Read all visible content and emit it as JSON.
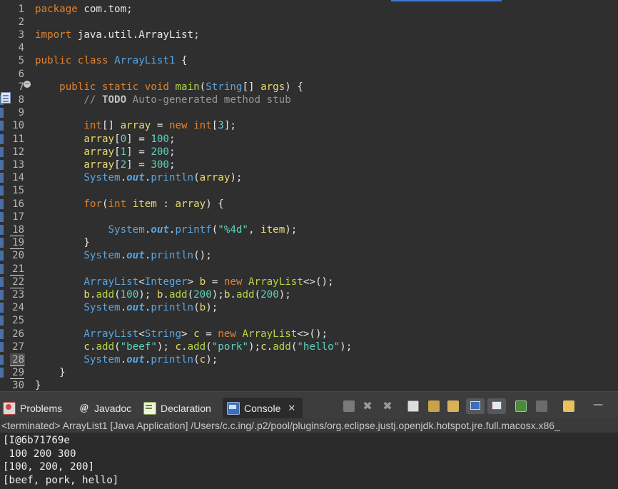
{
  "editor": {
    "line_numbers": [
      "1",
      "2",
      "3",
      "4",
      "5",
      "6",
      "7",
      "8",
      "9",
      "10",
      "11",
      "12",
      "13",
      "14",
      "15",
      "16",
      "17",
      "18",
      "19",
      "20",
      "21",
      "22",
      "23",
      "24",
      "25",
      "26",
      "27",
      "28",
      "29",
      "30"
    ],
    "lines": [
      [
        [
          "k",
          "package"
        ],
        [
          "p",
          " com.tom;"
        ]
      ],
      [],
      [
        [
          "k",
          "import"
        ],
        [
          "p",
          " java.util.ArrayList;"
        ]
      ],
      [],
      [
        [
          "k",
          "public"
        ],
        [
          "p",
          " "
        ],
        [
          "k",
          "class"
        ],
        [
          "p",
          " "
        ],
        [
          "t",
          "ArrayList1"
        ],
        [
          "p",
          " {"
        ]
      ],
      [],
      [
        [
          "p",
          "    "
        ],
        [
          "k",
          "public"
        ],
        [
          "p",
          " "
        ],
        [
          "k",
          "static"
        ],
        [
          "p",
          " "
        ],
        [
          "k",
          "void"
        ],
        [
          "p",
          " "
        ],
        [
          "f",
          "main"
        ],
        [
          "p",
          "("
        ],
        [
          "t",
          "String"
        ],
        [
          "p",
          "[] "
        ],
        [
          "v",
          "args"
        ],
        [
          "p",
          ") {"
        ]
      ],
      [
        [
          "p",
          "        "
        ],
        [
          "c",
          "// "
        ],
        [
          "cb",
          "TODO"
        ],
        [
          "c",
          " Auto-generated method stub"
        ]
      ],
      [],
      [
        [
          "p",
          "        "
        ],
        [
          "k",
          "int"
        ],
        [
          "p",
          "[] "
        ],
        [
          "v",
          "array"
        ],
        [
          "p",
          " = "
        ],
        [
          "k",
          "new"
        ],
        [
          "p",
          " "
        ],
        [
          "k",
          "int"
        ],
        [
          "p",
          "["
        ],
        [
          "s",
          "3"
        ],
        [
          "p",
          "];"
        ]
      ],
      [
        [
          "p",
          "        "
        ],
        [
          "v",
          "array"
        ],
        [
          "p",
          "["
        ],
        [
          "s",
          "0"
        ],
        [
          "p",
          "] = "
        ],
        [
          "s",
          "100"
        ],
        [
          "p",
          ";"
        ]
      ],
      [
        [
          "p",
          "        "
        ],
        [
          "v",
          "array"
        ],
        [
          "p",
          "["
        ],
        [
          "s",
          "1"
        ],
        [
          "p",
          "] = "
        ],
        [
          "s",
          "200"
        ],
        [
          "p",
          ";"
        ]
      ],
      [
        [
          "p",
          "        "
        ],
        [
          "v",
          "array"
        ],
        [
          "p",
          "["
        ],
        [
          "s",
          "2"
        ],
        [
          "p",
          "] = "
        ],
        [
          "s",
          "300"
        ],
        [
          "p",
          ";"
        ]
      ],
      [
        [
          "p",
          "        "
        ],
        [
          "t",
          "System"
        ],
        [
          "p",
          "."
        ],
        [
          "st",
          "out"
        ],
        [
          "p",
          "."
        ],
        [
          "t",
          "println"
        ],
        [
          "p",
          "("
        ],
        [
          "v",
          "array"
        ],
        [
          "p",
          ");"
        ]
      ],
      [],
      [
        [
          "p",
          "        "
        ],
        [
          "k",
          "for"
        ],
        [
          "p",
          "("
        ],
        [
          "k",
          "int"
        ],
        [
          "p",
          " "
        ],
        [
          "v",
          "item"
        ],
        [
          "p",
          " : "
        ],
        [
          "v",
          "array"
        ],
        [
          "p",
          ") {"
        ]
      ],
      [],
      [
        [
          "p",
          "            "
        ],
        [
          "t",
          "System"
        ],
        [
          "p",
          "."
        ],
        [
          "st",
          "out"
        ],
        [
          "p",
          "."
        ],
        [
          "t",
          "printf"
        ],
        [
          "p",
          "("
        ],
        [
          "s",
          "\"%4d\""
        ],
        [
          "p",
          ", "
        ],
        [
          "v",
          "item"
        ],
        [
          "p",
          ");"
        ]
      ],
      [
        [
          "p",
          "        }"
        ]
      ],
      [
        [
          "p",
          "        "
        ],
        [
          "t",
          "System"
        ],
        [
          "p",
          "."
        ],
        [
          "st",
          "out"
        ],
        [
          "p",
          "."
        ],
        [
          "t",
          "println"
        ],
        [
          "p",
          "();"
        ]
      ],
      [],
      [
        [
          "p",
          "        "
        ],
        [
          "t",
          "ArrayList"
        ],
        [
          "p",
          "<"
        ],
        [
          "t",
          "Integer"
        ],
        [
          "p",
          "> "
        ],
        [
          "v",
          "b"
        ],
        [
          "p",
          " = "
        ],
        [
          "k",
          "new"
        ],
        [
          "p",
          " "
        ],
        [
          "f",
          "ArrayList"
        ],
        [
          "p",
          "<>();"
        ]
      ],
      [
        [
          "p",
          "        "
        ],
        [
          "v",
          "b"
        ],
        [
          "p",
          "."
        ],
        [
          "f",
          "add"
        ],
        [
          "p",
          "("
        ],
        [
          "s",
          "100"
        ],
        [
          "p",
          "); "
        ],
        [
          "v",
          "b"
        ],
        [
          "p",
          "."
        ],
        [
          "f",
          "add"
        ],
        [
          "p",
          "("
        ],
        [
          "s",
          "200"
        ],
        [
          "p",
          ");"
        ],
        [
          "v",
          "b"
        ],
        [
          "p",
          "."
        ],
        [
          "f",
          "add"
        ],
        [
          "p",
          "("
        ],
        [
          "s",
          "200"
        ],
        [
          "p",
          ");"
        ]
      ],
      [
        [
          "p",
          "        "
        ],
        [
          "t",
          "System"
        ],
        [
          "p",
          "."
        ],
        [
          "st",
          "out"
        ],
        [
          "p",
          "."
        ],
        [
          "t",
          "println"
        ],
        [
          "p",
          "("
        ],
        [
          "v",
          "b"
        ],
        [
          "p",
          ");"
        ]
      ],
      [],
      [
        [
          "p",
          "        "
        ],
        [
          "t",
          "ArrayList"
        ],
        [
          "p",
          "<"
        ],
        [
          "t",
          "String"
        ],
        [
          "p",
          "> "
        ],
        [
          "v",
          "c"
        ],
        [
          "p",
          " = "
        ],
        [
          "k",
          "new"
        ],
        [
          "p",
          " "
        ],
        [
          "f",
          "ArrayList"
        ],
        [
          "p",
          "<>();"
        ]
      ],
      [
        [
          "p",
          "        "
        ],
        [
          "v",
          "c"
        ],
        [
          "p",
          "."
        ],
        [
          "f",
          "add"
        ],
        [
          "p",
          "("
        ],
        [
          "s",
          "\"beef\""
        ],
        [
          "p",
          "); "
        ],
        [
          "v",
          "c"
        ],
        [
          "p",
          "."
        ],
        [
          "f",
          "add"
        ],
        [
          "p",
          "("
        ],
        [
          "s",
          "\"pork\""
        ],
        [
          "p",
          ");"
        ],
        [
          "v",
          "c"
        ],
        [
          "p",
          "."
        ],
        [
          "f",
          "add"
        ],
        [
          "p",
          "("
        ],
        [
          "s",
          "\"hello\""
        ],
        [
          "p",
          ");"
        ]
      ],
      [
        [
          "p",
          "        "
        ],
        [
          "t",
          "System"
        ],
        [
          "p",
          "."
        ],
        [
          "st",
          "out"
        ],
        [
          "p",
          "."
        ],
        [
          "t",
          "println"
        ],
        [
          "p",
          "("
        ],
        [
          "v",
          "c"
        ],
        [
          "p",
          ");"
        ]
      ],
      [
        [
          "p",
          "    }"
        ]
      ],
      [
        [
          "p",
          "}"
        ]
      ]
    ]
  },
  "panel": {
    "tabs": [
      {
        "label": "Problems",
        "icon": "problems-icon"
      },
      {
        "label": "Javadoc",
        "icon": "javadoc-icon"
      },
      {
        "label": "Declaration",
        "icon": "declaration-icon"
      },
      {
        "label": "Console",
        "icon": "console-icon",
        "active": true
      }
    ],
    "close_symbol": "✕",
    "toolbar_buttons": [
      "terminate-button",
      "remove-launch-button",
      "remove-all-terminated-button",
      "scroll-lock-button",
      "word-wrap-button",
      "show-on-output-button",
      "show-on-error-button",
      "pin-console-button",
      "display-console-button",
      "open-console-button",
      "minimize-button"
    ],
    "status_line": "<terminated> ArrayList1 [Java Application] /Users/c.c.ing/.p2/pool/plugins/org.eclipse.justj.openjdk.hotspot.jre.full.macosx.x86_",
    "output": [
      "[I@6b71769e",
      " 100 200 300",
      "[100, 200, 200]",
      "[beef, pork, hello]"
    ],
    "minimize_label": "—"
  },
  "colors": {
    "keyword": "#e2822c",
    "type": "#57a5e3",
    "method": "#b2d545",
    "variable": "#eadb6b",
    "literal": "#5dd3bd",
    "comment": "#959595",
    "background": "#2f2f2f"
  }
}
